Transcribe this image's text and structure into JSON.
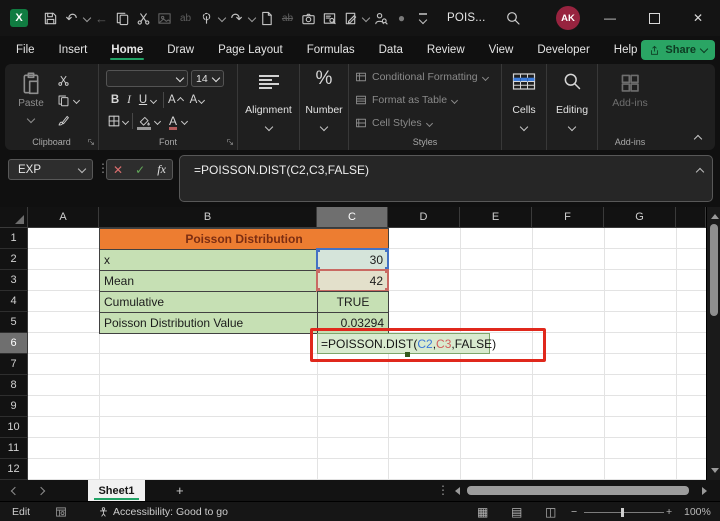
{
  "titlebar": {
    "doc_title": "POIS...",
    "avatar_initials": "AK"
  },
  "menu": {
    "tabs": [
      "File",
      "Insert",
      "Home",
      "Draw",
      "Page Layout",
      "Formulas",
      "Data",
      "Review",
      "View",
      "Developer",
      "Help"
    ],
    "active_tab": "Home",
    "share_label": "Share"
  },
  "ribbon": {
    "paste_label": "Paste",
    "clipboard_group": "Clipboard",
    "font_group": "Font",
    "font_size": "14",
    "bold": "B",
    "italic": "I",
    "underline": "U",
    "font_letter": "A",
    "alignment_label": "Alignment",
    "number_label": "Number",
    "styles_items": [
      "Conditional Formatting",
      "Format as Table",
      "Cell Styles"
    ],
    "styles_group": "Styles",
    "cells_label": "Cells",
    "editing_label": "Editing",
    "addins_label": "Add-ins",
    "addins_group": "Add-ins"
  },
  "formula_bar": {
    "name_box": "EXP",
    "fx_label": "fx",
    "cancel_glyph": "✕",
    "enter_glyph": "✓",
    "formula": "=POISSON.DIST(C2,C3,FALSE)"
  },
  "grid": {
    "columns": [
      "A",
      "B",
      "C",
      "D",
      "E",
      "F",
      "G"
    ],
    "active_column": "C",
    "rows": [
      "1",
      "2",
      "3",
      "4",
      "5",
      "6",
      "7",
      "8",
      "9",
      "10",
      "11",
      "12"
    ],
    "active_row": "6",
    "table_title": "Poisson Distribution",
    "labels": [
      "x",
      "Mean",
      "Cumulative",
      "Poisson Distribution Value"
    ],
    "values": [
      "30",
      "42",
      "TRUE",
      "0.03294"
    ],
    "edit_formula": {
      "p1": "=POISSON.DIST(",
      "ref1": "C2",
      "comma": ",",
      "ref2": "C3",
      "p2": ",FALSE)"
    }
  },
  "sheet_bar": {
    "sheet_name": "Sheet1",
    "add_glyph": "+",
    "menu_glyph": "⋮"
  },
  "status_bar": {
    "mode": "Edit",
    "accessibility": "Accessibility: Good to go",
    "zoom_level": "100%",
    "minus_glyph": "−",
    "plus_glyph": "+",
    "view_normal_glyph": "▦",
    "view_layout_glyph": "▤",
    "view_break_glyph": "◫"
  },
  "glyphs": {
    "undo": "↶",
    "redo": "↷",
    "back": "←",
    "replace_ab": "ab",
    "strike_ab": "ab",
    "circle": "●",
    "dots_v": "⋮",
    "percent": "%",
    "minimize": "—",
    "close": "✕"
  },
  "colors": {
    "accent_green": "#21A366",
    "header_orange": "#ED7D31",
    "cell_green": "#C6E0B4",
    "ref_blue": "#4472C4",
    "ref_red": "#C96A63",
    "annotation_red": "#E0281C",
    "avatar_bg": "#97233F"
  }
}
